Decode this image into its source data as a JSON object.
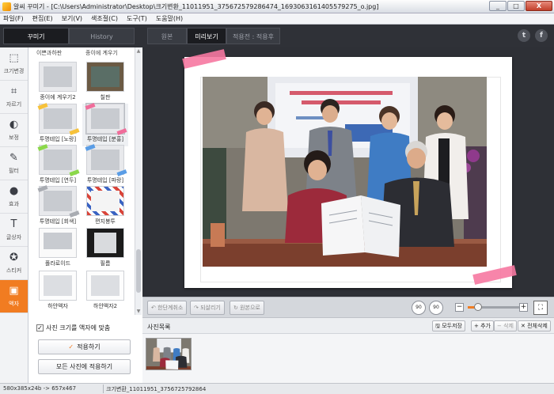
{
  "window": {
    "title": "알씨 꾸미기 - [C:\\Users\\Administrator\\Desktop\\크기변환_11011951_375672579286474_1693063161405579275_o.jpg]",
    "minimize": "_",
    "maximize": "□",
    "close": "X"
  },
  "menu": [
    "파일(F)",
    "편집(E)",
    "보기(V)",
    "색조절(C)",
    "도구(T)",
    "도움말(H)"
  ],
  "mode_tabs": [
    {
      "label": "꾸미기",
      "active": true
    },
    {
      "label": "History",
      "active": false
    }
  ],
  "view_tabs": [
    {
      "label": "원본",
      "active": false
    },
    {
      "label": "미리보기",
      "active": true
    },
    {
      "label": "적용전 : 적용후",
      "active": false
    }
  ],
  "social": {
    "twitter": "t",
    "facebook": "f"
  },
  "tools": [
    {
      "label": "크기변경",
      "icon": "resize-icon",
      "glyph": "⬚",
      "active": false
    },
    {
      "label": "자르기",
      "icon": "crop-icon",
      "glyph": "⌗",
      "active": false
    },
    {
      "label": "보정",
      "icon": "adjust-icon",
      "glyph": "◐",
      "active": false
    },
    {
      "label": "필터",
      "icon": "filter-wand-icon",
      "glyph": "✎",
      "active": false
    },
    {
      "label": "효과",
      "icon": "effect-drop-icon",
      "glyph": "●",
      "active": false
    },
    {
      "label": "글상자",
      "icon": "text-icon",
      "glyph": "T",
      "active": false
    },
    {
      "label": "스티커",
      "icon": "sticker-icon",
      "glyph": "✪",
      "active": false
    },
    {
      "label": "액자",
      "icon": "frame-icon",
      "glyph": "▣",
      "active": true
    }
  ],
  "frames": {
    "top_partial": [
      "이쁜과하판",
      "종이에 계우기"
    ],
    "items": [
      {
        "label": "종이에 계우기2",
        "tape": ""
      },
      {
        "label": "칠판",
        "tape": "chalk"
      },
      {
        "label": "투명테입 [노랑]",
        "tape": "#f7c23a"
      },
      {
        "label": "투명테입 [분홍]",
        "tape": "#f06d9a"
      },
      {
        "label": "투명테입 [연두]",
        "tape": "#8bd84a"
      },
      {
        "label": "투명테입 [파랑]",
        "tape": "#5a9de6"
      },
      {
        "label": "투명테입 [회색]",
        "tape": "#a9acb2"
      },
      {
        "label": "편지봉투",
        "tape": "airmail"
      },
      {
        "label": "폴라로이드",
        "tape": "polaroid"
      },
      {
        "label": "필름",
        "tape": "film"
      },
      {
        "label": "하얀액자",
        "tape": "white"
      },
      {
        "label": "하얀액자2",
        "tape": "white2"
      }
    ]
  },
  "fit_checkbox": {
    "label": "사진 크기를 액자에 맞춤",
    "checked": "✓"
  },
  "buttons": {
    "apply": "적용하기",
    "apply_check": "✓",
    "apply_all": "모든 사진에 적용하기"
  },
  "canvas_toolbar": {
    "undo": "↶ 한단계취소",
    "redo": "↷ 되살리기",
    "reset": "↻ 원본으로",
    "rotate_left": "90",
    "rotate_right": "90",
    "zoom_minus": "−",
    "zoom_plus": "+",
    "zoom_level": 0.2,
    "fit_screen": "⛶"
  },
  "photo_list": {
    "title": "사진목록",
    "save_all": "모두저장",
    "add": "+ 추가",
    "delete": "− 삭제",
    "delete_all": "✕ 전체삭제"
  },
  "status": {
    "size": "580x385x24b -> 657x467",
    "filename": "크기변환_11011951_3756725792864"
  },
  "accent_color": "#f17c21"
}
